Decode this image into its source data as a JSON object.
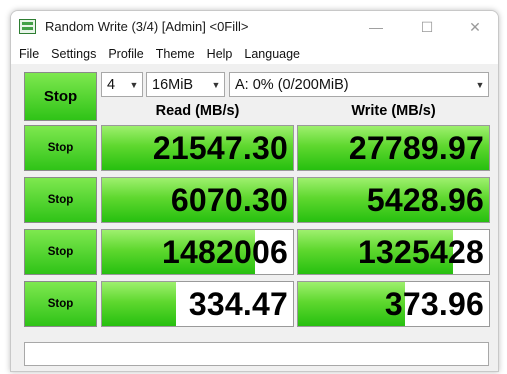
{
  "window": {
    "title": "Random Write (3/4) [Admin] <0Fill>"
  },
  "menu": [
    "File",
    "Settings",
    "Profile",
    "Theme",
    "Help",
    "Language"
  ],
  "controls": {
    "all_button": "Stop",
    "count": "4",
    "size": "16MiB",
    "drive": "A: 0% (0/200MiB)"
  },
  "headers": {
    "read": "Read (MB/s)",
    "write": "Write (MB/s)"
  },
  "rows": [
    {
      "button": "Stop",
      "read": "21547.30",
      "write": "27789.97",
      "read_fill": 1.0,
      "write_fill": 1.0
    },
    {
      "button": "Stop",
      "read": "6070.30",
      "write": "5428.96",
      "read_fill": 1.0,
      "write_fill": 1.0
    },
    {
      "button": "Stop",
      "read": "1482006",
      "write": "1325428",
      "read_fill": 0.8,
      "write_fill": 0.81
    },
    {
      "button": "Stop",
      "read": "334.47",
      "write": "373.96",
      "read_fill": 0.39,
      "write_fill": 0.56
    }
  ],
  "comment": ""
}
